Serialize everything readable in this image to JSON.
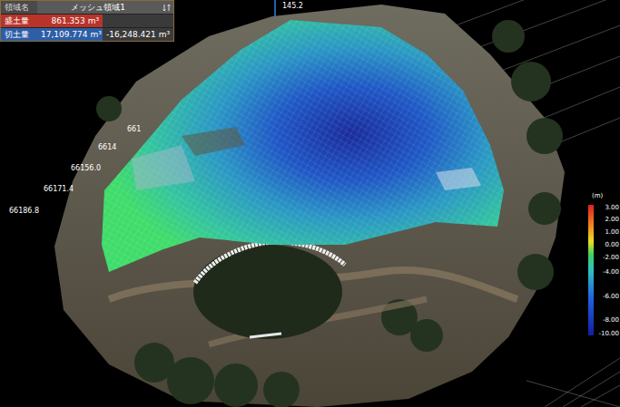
{
  "panel": {
    "header": {
      "label": "領域名",
      "value": "メッシュ領域1"
    },
    "rows": [
      {
        "label": "盛土量",
        "value": "861.353 m³",
        "color": "#b8342a"
      },
      {
        "label": "切土量",
        "value": "17,109.774 m³",
        "color": "#2d5ea6"
      }
    ],
    "net": "-16,248.421 m³"
  },
  "axis_labels": [
    "145.2",
    "661",
    "6614",
    "66156.0",
    "66171.4",
    "66186.8"
  ],
  "legend": {
    "unit": "(m)",
    "ticks": [
      "3.00",
      "2.00",
      "1.00",
      "0.00",
      "-2.00",
      "-4.00",
      "-6.00",
      "-8.00",
      "-10.00"
    ]
  }
}
